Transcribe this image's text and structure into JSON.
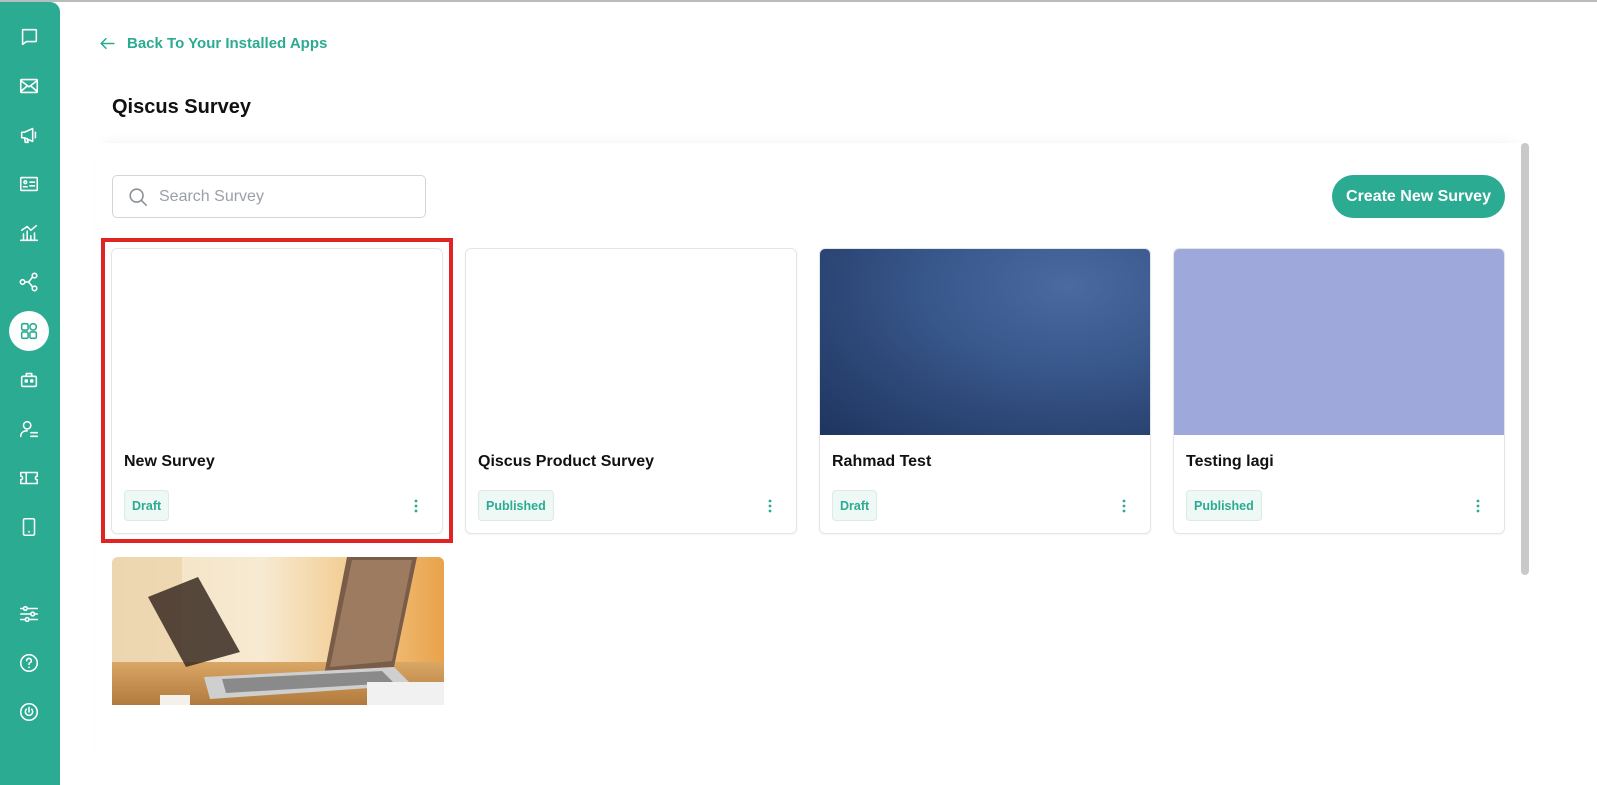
{
  "back_link": {
    "label": "Back To Your Installed Apps"
  },
  "page": {
    "title": "Qiscus Survey"
  },
  "search": {
    "placeholder": "Search Survey",
    "value": ""
  },
  "toolbar": {
    "create_label": "Create New Survey"
  },
  "colors": {
    "accent": "#2bab92",
    "highlight": "#e02424",
    "badge_bg": "#eef8f5"
  },
  "sidebar": {
    "items": [
      {
        "icon": "chat-icon"
      },
      {
        "icon": "mail-icon"
      },
      {
        "icon": "megaphone-icon"
      },
      {
        "icon": "contact-card-icon"
      },
      {
        "icon": "analytics-icon"
      },
      {
        "icon": "integration-icon"
      },
      {
        "icon": "apps-icon",
        "active": true
      },
      {
        "icon": "bot-icon"
      },
      {
        "icon": "agent-icon"
      },
      {
        "icon": "ticket-icon"
      },
      {
        "icon": "mobile-icon"
      },
      {
        "icon": "settings-sliders-icon"
      },
      {
        "icon": "help-icon"
      },
      {
        "icon": "power-icon"
      }
    ]
  },
  "surveys": [
    {
      "title": "New Survey",
      "status": "Draft",
      "thumbnail": "none"
    },
    {
      "title": "Qiscus Product Survey",
      "status": "Published",
      "thumbnail": "none"
    },
    {
      "title": "Rahmad Test",
      "status": "Draft",
      "thumbnail": "blue-texture"
    },
    {
      "title": "Testing lagi",
      "status": "Published",
      "thumbnail": "lavender"
    },
    {
      "title": "",
      "status": "",
      "thumbnail": "laptop-photo"
    }
  ]
}
